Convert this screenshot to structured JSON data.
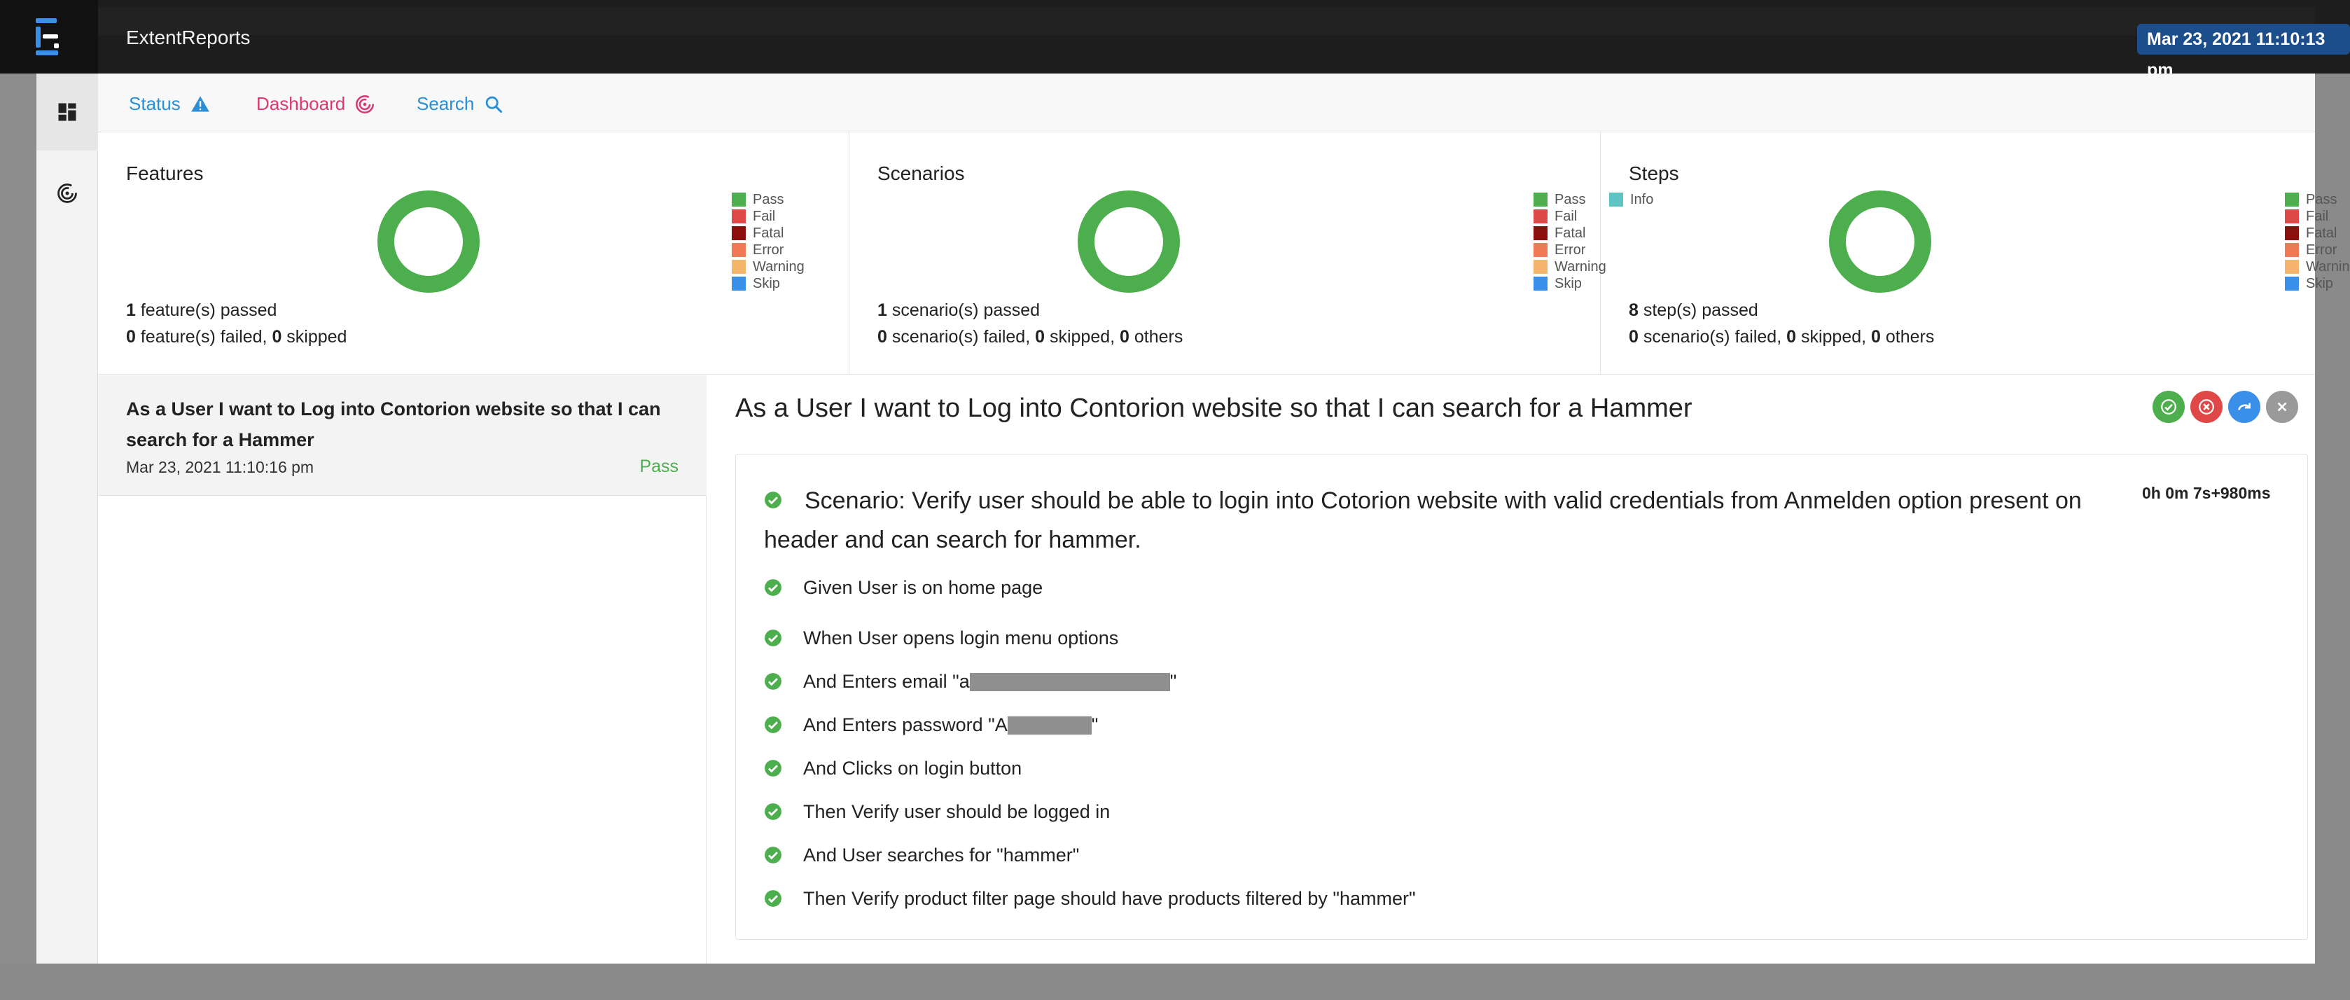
{
  "app": {
    "brand": "ExtentReports",
    "timestamp": "Mar 23, 2021 11:10:13 pm",
    "logo_icon": "extent-logo-icon"
  },
  "sidebar": {
    "items": [
      {
        "name": "dashboard-grid",
        "icon": "grid-icon"
      },
      {
        "name": "dashboard-target",
        "icon": "target-icon"
      }
    ]
  },
  "nav": {
    "status_label": "Status",
    "status_icon": "warning-icon",
    "dashboard_label": "Dashboard",
    "dashboard_icon": "target-icon",
    "search_label": "Search",
    "search_icon": "search-icon"
  },
  "legend_labels": {
    "pass": "Pass",
    "fail": "Fail",
    "fatal": "Fatal",
    "error": "Error",
    "warning": "Warning",
    "skip": "Skip",
    "info": "Info"
  },
  "colors": {
    "pass": "#4cae4c",
    "fail": "#e04848",
    "fatal": "#8b1010",
    "error": "#ee7a55",
    "warning": "#f5b56b",
    "skip": "#3a8fe8",
    "info": "#5ec4c4"
  },
  "cards": {
    "features": {
      "title": "Features",
      "passed_count": "1",
      "passed_text": " feature(s) passed",
      "failed_count": "0",
      "failed_text": " feature(s) failed, ",
      "skipped_count": "0",
      "skipped_text": " skipped"
    },
    "scenarios": {
      "title": "Scenarios",
      "passed_count": "1",
      "passed_text": " scenario(s) passed",
      "failed_count": "0",
      "failed_text": " scenario(s) failed, ",
      "skipped_count": "0",
      "skipped_text": " skipped, ",
      "others_count": "0",
      "others_text": " others"
    },
    "steps": {
      "title": "Steps",
      "passed_count": "8",
      "passed_text": " step(s) passed",
      "failed_count": "0",
      "failed_text": " scenario(s) failed, ",
      "skipped_count": "0",
      "skipped_text": " skipped, ",
      "others_count": "0",
      "others_text": " others"
    }
  },
  "test_list": {
    "name": "As a User I want to Log into Contorion website so that I can search for a Hammer",
    "time": "Mar 23, 2021 11:10:16 pm",
    "status": "Pass"
  },
  "detail": {
    "title": "As a User I want to Log into Contorion website so that I can search for a Hammer",
    "scenario": "Scenario: Verify user should be able to login into Cotorion website with valid credentials from Anmelden option present on header and can search for hammer.",
    "duration": "0h 0m 7s+980ms",
    "steps": [
      {
        "text": "Given User is on home page"
      },
      {
        "text": "When User opens login menu options"
      },
      {
        "prefix": "And Enters email \"",
        "visible": "a",
        "suffix": "\""
      },
      {
        "prefix": "And Enters password \"",
        "visible": "A",
        "suffix": "\""
      },
      {
        "text": "And Clicks on login button"
      },
      {
        "text": "Then Verify user should be logged in"
      },
      {
        "text": "And User searches for \"hammer\""
      },
      {
        "text": "Then Verify product filter page should have products filtered by \"hammer\""
      }
    ]
  }
}
